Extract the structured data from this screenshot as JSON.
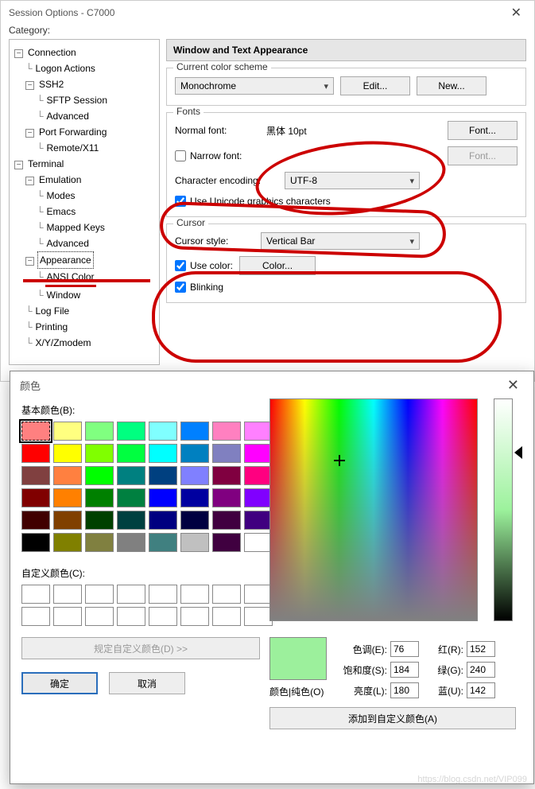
{
  "window": {
    "title": "Session Options - C7000",
    "category_label": "Category:"
  },
  "tree": {
    "connection": "Connection",
    "logon": "Logon Actions",
    "ssh2": "SSH2",
    "sftp": "SFTP Session",
    "advanced1": "Advanced",
    "portfwd": "Port Forwarding",
    "remotex11": "Remote/X11",
    "terminal": "Terminal",
    "emulation": "Emulation",
    "modes": "Modes",
    "emacs": "Emacs",
    "mapped": "Mapped Keys",
    "advanced2": "Advanced",
    "appearance": "Appearance",
    "ansi": "ANSI Color",
    "winnode": "Window",
    "logfile": "Log File",
    "printing": "Printing",
    "xyzmodem": "X/Y/Zmodem"
  },
  "panel": {
    "title": "Window and Text Appearance"
  },
  "scheme": {
    "legend": "Current color scheme",
    "value": "Monochrome",
    "edit": "Edit...",
    "new": "New..."
  },
  "fonts": {
    "legend": "Fonts",
    "normal_label": "Normal font:",
    "normal_value": "黑体  10pt",
    "font_btn": "Font...",
    "narrow_label": "Narrow font:",
    "font_btn2": "Font...",
    "enc_label": "Character encoding:",
    "enc_value": "UTF-8",
    "unicode_label": "Use Unicode graphics characters"
  },
  "cursor": {
    "legend": "Cursor",
    "style_label": "Cursor style:",
    "style_value": "Vertical Bar",
    "usecolor_label": "Use color:",
    "color_btn": "Color...",
    "blinking_label": "Blinking"
  },
  "colordlg": {
    "title": "颜色",
    "basic_label": "基本颜色(B):",
    "custom_label": "自定义颜色(C):",
    "define_label": "规定自定义颜色(D) >>",
    "ok": "确定",
    "cancel": "取消",
    "preview_label": "颜色|纯色(O)",
    "hue_label": "色调(E):",
    "sat_label": "饱和度(S):",
    "lum_label": "亮度(L):",
    "r_label": "红(R):",
    "g_label": "绿(G):",
    "b_label": "蓝(U):",
    "hue": "76",
    "sat": "184",
    "lum": "180",
    "r": "152",
    "g": "240",
    "b": "142",
    "add_label": "添加到自定义颜色(A)",
    "preview_color": "#9cf09c",
    "basic_colors": [
      "#ff8080",
      "#ffff80",
      "#80ff80",
      "#00ff80",
      "#80ffff",
      "#0080ff",
      "#ff80c0",
      "#ff80ff",
      "#ff0000",
      "#ffff00",
      "#80ff00",
      "#00ff40",
      "#00ffff",
      "#0080c0",
      "#8080c0",
      "#ff00ff",
      "#804040",
      "#ff8040",
      "#00ff00",
      "#008080",
      "#004080",
      "#8080ff",
      "#800040",
      "#ff0080",
      "#800000",
      "#ff8000",
      "#008000",
      "#008040",
      "#0000ff",
      "#0000a0",
      "#800080",
      "#8000ff",
      "#400000",
      "#804000",
      "#004000",
      "#004040",
      "#000080",
      "#000040",
      "#400040",
      "#400080",
      "#000000",
      "#808000",
      "#808040",
      "#808080",
      "#408080",
      "#c0c0c0",
      "#400040",
      "#ffffff"
    ]
  },
  "watermark": "https://blog.csdn.net/VIP099"
}
